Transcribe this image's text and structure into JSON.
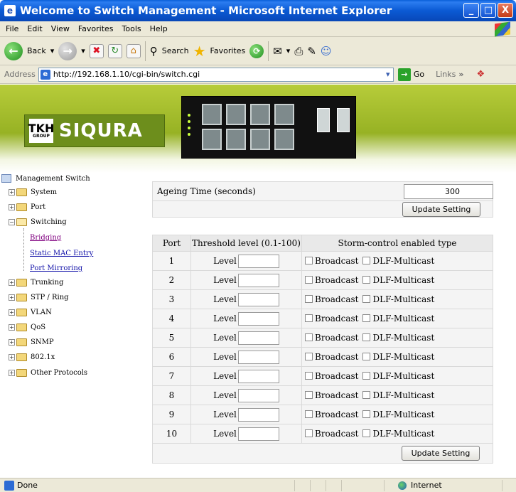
{
  "window": {
    "title": "Welcome to Switch Management - Microsoft Internet Explorer",
    "minimize": "_",
    "maximize": "□",
    "close": "X"
  },
  "menu": [
    "File",
    "Edit",
    "View",
    "Favorites",
    "Tools",
    "Help"
  ],
  "toolbar": {
    "back": "Back",
    "search": "Search",
    "favorites": "Favorites"
  },
  "address": {
    "label": "Address",
    "url": "http://192.168.1.10/cgi-bin/switch.cgi",
    "go": "Go",
    "links": "Links"
  },
  "banner": {
    "logo_top": "TKH",
    "logo_small": "GROUP",
    "logo_brand": "SIQURA"
  },
  "tree": {
    "root": "Management Switch",
    "items": [
      {
        "label": "System",
        "expanded": false
      },
      {
        "label": "Port",
        "expanded": false
      },
      {
        "label": "Switching",
        "expanded": true
      }
    ],
    "switching_children": [
      "Bridging",
      "Static MAC Entry",
      "Port Mirroring"
    ],
    "items_after": [
      "Trunking",
      "STP / Ring",
      "VLAN",
      "QoS",
      "SNMP",
      "802.1x",
      "Other Protocols"
    ]
  },
  "ageing": {
    "label": "Ageing Time (seconds)",
    "value": "300",
    "button": "Update Setting"
  },
  "storm": {
    "headers": [
      "Port",
      "Threshold level (0.1-100)",
      "Storm-control enabled type"
    ],
    "level_label": "Level",
    "broadcast_label": "Broadcast",
    "dlf_label": "DLF-Multicast",
    "ports": [
      "1",
      "2",
      "3",
      "4",
      "5",
      "6",
      "7",
      "8",
      "9",
      "10"
    ],
    "button": "Update Setting"
  },
  "status": {
    "text": "Done",
    "zone": "Internet"
  },
  "colors": {
    "titlebar": "#0b5ad4",
    "banner": "#9bb52a",
    "chrome": "#ece9d8",
    "link": "#1010a8",
    "visited": "#800080"
  }
}
